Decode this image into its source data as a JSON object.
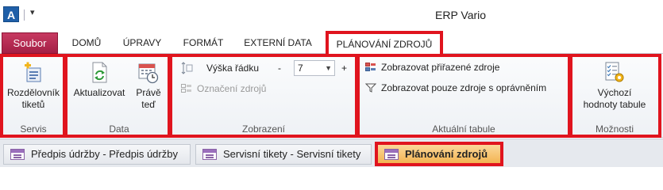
{
  "titlebar": {
    "logo_letter": "A",
    "qat_dropdown": "▾",
    "title": "ERP Vario"
  },
  "tabs": {
    "file": "Soubor",
    "home": "DOMŮ",
    "edit": "ÚPRAVY",
    "format": "FORMÁT",
    "external": "EXTERNÍ DATA",
    "planning": "PLÁNOVÁNÍ ZDROJŮ"
  },
  "ribbon": {
    "servis": {
      "split_line1": "Rozdělovník",
      "split_line2": "tiketů",
      "label": "Servis"
    },
    "data": {
      "refresh": "Aktualizovat",
      "now_line1": "Právě",
      "now_line2": "teď",
      "label": "Data"
    },
    "view": {
      "row_height": "Výška řádku",
      "minus": "-",
      "plus": "+",
      "combo_value": "7",
      "resource_mark": "Označení zdrojů",
      "label": "Zobrazení"
    },
    "current_table": {
      "show_assigned": "Zobrazovat přiřazené zdroje",
      "show_authorized": "Zobrazovat pouze zdroje s oprávněním",
      "label": "Aktuální tabule"
    },
    "options": {
      "default_line1": "Výchozí",
      "default_line2": "hodnoty tabule",
      "label": "Možnosti"
    }
  },
  "doc_tabs": [
    {
      "label": "Předpis údržby - Předpis údržby"
    },
    {
      "label": "Servisní tikety - Servisní tikety"
    },
    {
      "label": "Plánování zdrojů"
    }
  ],
  "colors": {
    "highlight": "#e0141e",
    "file_tab": "#b52a52",
    "active_doctab": "#f3b452"
  }
}
